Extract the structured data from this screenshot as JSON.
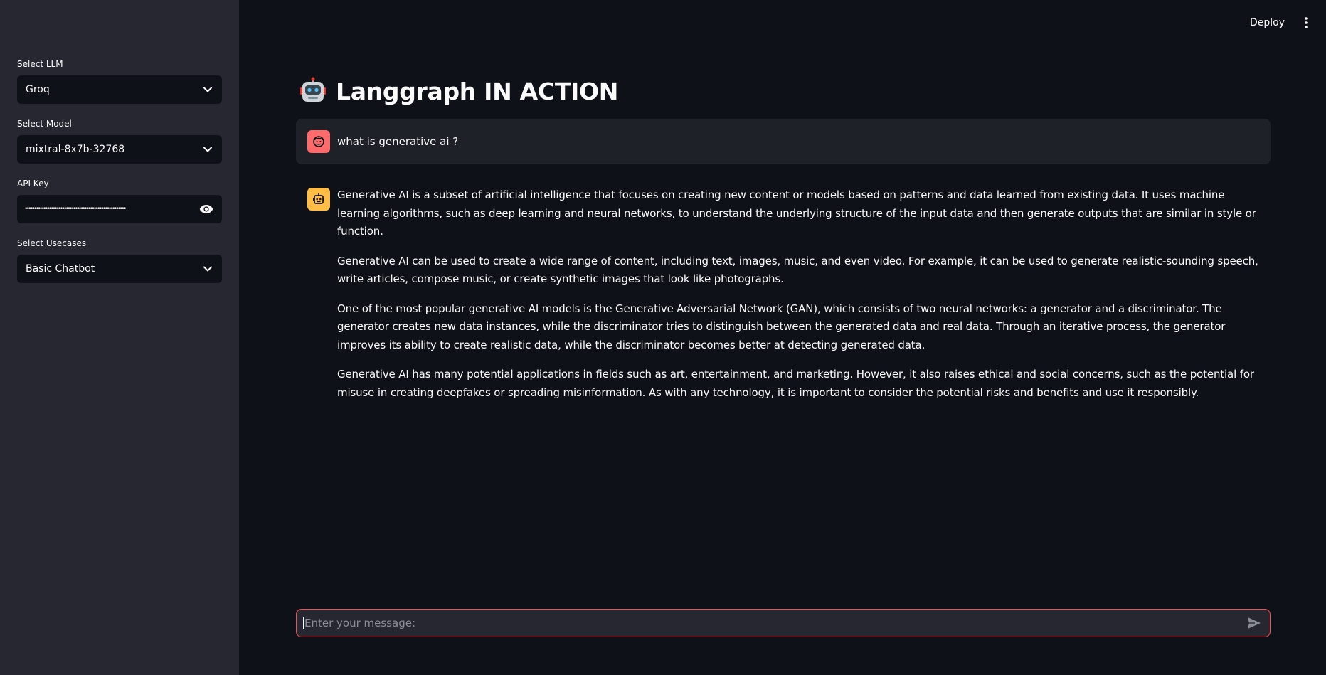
{
  "sidebar": {
    "llm": {
      "label": "Select LLM",
      "value": "Groq"
    },
    "model": {
      "label": "Select Model",
      "value": "mixtral-8x7b-32768"
    },
    "api_key": {
      "label": "API Key",
      "masked_value": "••••••••••••••••••••••••••••••••••••••••••••••••••••••"
    },
    "usecase": {
      "label": "Select Usecases",
      "value": "Basic Chatbot"
    }
  },
  "header": {
    "deploy_label": "Deploy"
  },
  "main": {
    "title": "Langgraph IN ACTION",
    "user_message": "what is generative ai ?",
    "assistant_paragraphs": [
      "Generative AI is a subset of artificial intelligence that focuses on creating new content or models based on patterns and data learned from existing data. It uses machine learning algorithms, such as deep learning and neural networks, to understand the underlying structure of the input data and then generate outputs that are similar in style or function.",
      "Generative AI can be used to create a wide range of content, including text, images, music, and even video. For example, it can be used to generate realistic-sounding speech, write articles, compose music, or create synthetic images that look like photographs.",
      "One of the most popular generative AI models is the Generative Adversarial Network (GAN), which consists of two neural networks: a generator and a discriminator. The generator creates new data instances, while the discriminator tries to distinguish between the generated data and real data. Through an iterative process, the generator improves its ability to create realistic data, while the discriminator becomes better at detecting generated data.",
      "Generative AI has many potential applications in fields such as art, entertainment, and marketing. However, it also raises ethical and social concerns, such as the potential for misuse in creating deepfakes or spreading misinformation. As with any technology, it is important to consider the potential risks and benefits and use it responsibly."
    ]
  },
  "chat_input": {
    "placeholder": "Enter your message:"
  },
  "colors": {
    "sidebar_bg": "#262730",
    "main_bg": "#0e1117",
    "accent": "#ff4b4b",
    "user_avatar": "#ff6b6b",
    "bot_avatar": "#ffbd45"
  },
  "icons": {
    "select_chevron": "chevron-down-icon",
    "password_toggle": "eye-icon",
    "menu": "kebab-menu-icon",
    "title": "robot-emoji-icon",
    "user_avatar": "user-face-icon",
    "bot_avatar": "robot-icon",
    "send": "send-icon"
  }
}
